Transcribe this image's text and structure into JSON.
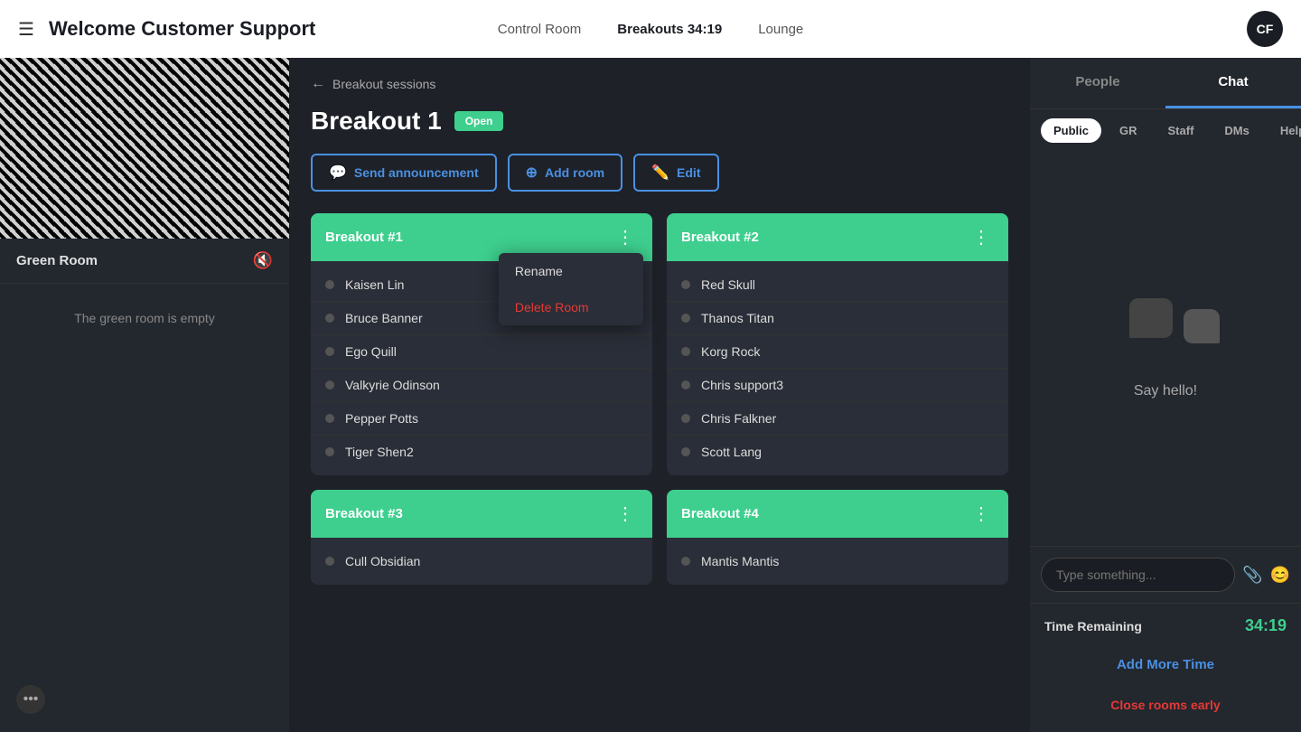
{
  "nav": {
    "menu_icon": "☰",
    "title": "Welcome Customer Support",
    "links": [
      {
        "label": "Control Room",
        "active": false
      },
      {
        "label": "Breakouts 34:19",
        "active": true
      },
      {
        "label": "Lounge",
        "active": false
      }
    ],
    "avatar": "CF"
  },
  "left_panel": {
    "green_room_label": "Green Room",
    "green_room_empty": "The green room is empty",
    "dots_icon": "•••"
  },
  "center": {
    "breadcrumb": "Breakout sessions",
    "page_title": "Breakout 1",
    "open_badge": "Open",
    "actions": [
      {
        "label": "Send announcement",
        "icon": "💬"
      },
      {
        "label": "Add room",
        "icon": "+"
      },
      {
        "label": "Edit",
        "icon": "✏️"
      }
    ],
    "rooms": [
      {
        "id": "breakout1",
        "title": "Breakout #1",
        "participants": [
          "Kaisen Lin",
          "Bruce Banner",
          "Ego Quill",
          "Valkyrie Odinson",
          "Pepper Potts",
          "Tiger Shen2"
        ],
        "show_context_menu": true
      },
      {
        "id": "breakout2",
        "title": "Breakout #2",
        "participants": [
          "Red Skull",
          "Thanos Titan",
          "Korg Rock",
          "Chris support3",
          "Chris Falkner",
          "Scott Lang"
        ],
        "show_context_menu": false
      },
      {
        "id": "breakout3",
        "title": "Breakout #3",
        "participants": [
          "Cull Obsidian"
        ],
        "show_context_menu": false
      },
      {
        "id": "breakout4",
        "title": "Breakout #4",
        "participants": [
          "Mantis Mantis"
        ],
        "show_context_menu": false
      }
    ],
    "context_menu": {
      "rename": "Rename",
      "delete": "Delete Room"
    }
  },
  "right_panel": {
    "tabs": [
      {
        "label": "People",
        "active": false
      },
      {
        "label": "Chat",
        "active": true
      }
    ],
    "filter_tabs": [
      {
        "label": "Public",
        "active": true
      },
      {
        "label": "GR",
        "active": false
      },
      {
        "label": "Staff",
        "active": false
      },
      {
        "label": "DMs",
        "active": false
      },
      {
        "label": "Help",
        "active": false
      }
    ],
    "chat_empty": "Say hello!",
    "chat_input_placeholder": "Type something...",
    "time_remaining_label": "Time Remaining",
    "time_remaining_value": "34:19",
    "add_more_time": "Add More Time",
    "close_rooms_early": "Close rooms early"
  }
}
